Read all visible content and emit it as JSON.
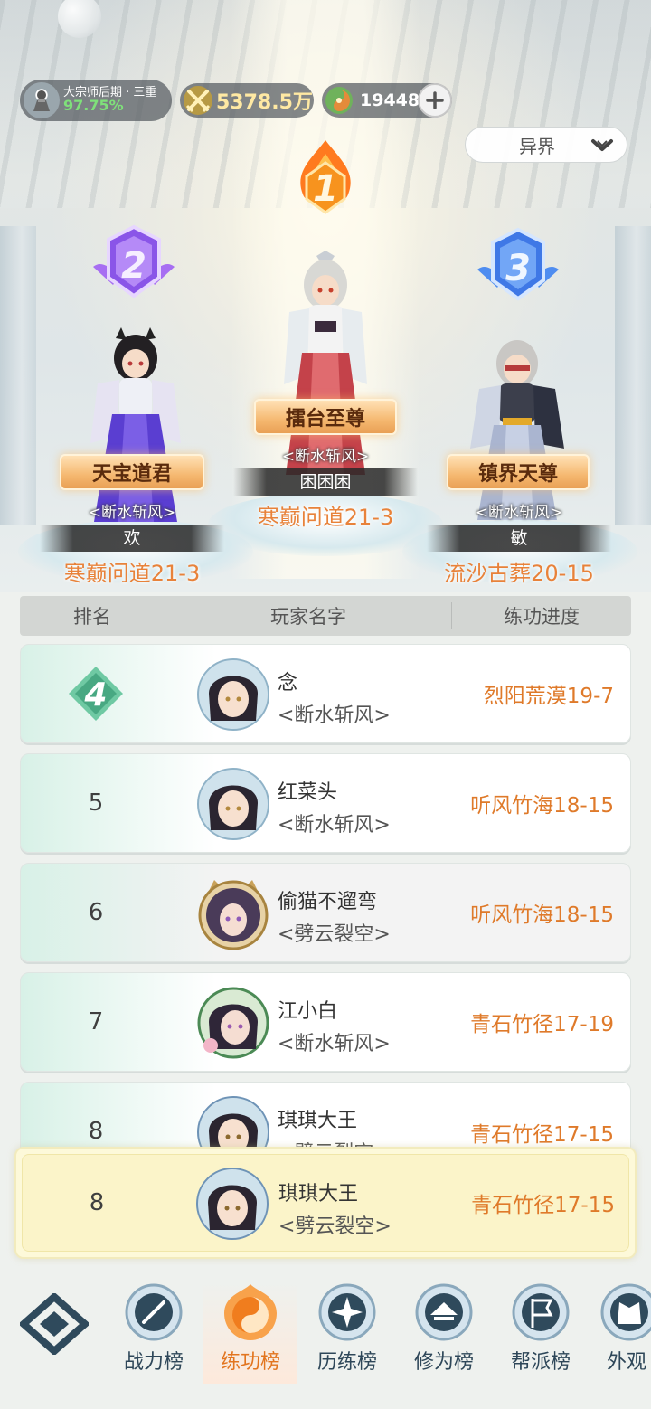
{
  "status": {
    "realm_title": "大宗师后期 · 三重",
    "realm_percent": "97.75%",
    "power": "5378.5万",
    "jade": "19448"
  },
  "filter": {
    "selected": "异界"
  },
  "top3": [
    {
      "rank": "1",
      "title": "擂台至尊",
      "guild": "<断水斩风>",
      "name": "困困困",
      "progress": "寒巅问道21-3"
    },
    {
      "rank": "2",
      "title": "天宝道君",
      "guild": "<断水斩风>",
      "name": "欢",
      "progress": "寒巅问道21-3"
    },
    {
      "rank": "3",
      "title": "镇界天尊",
      "guild": "<断水斩风>",
      "name": "敏",
      "progress": "流沙古葬20-15"
    }
  ],
  "table": {
    "headers": {
      "rank": "排名",
      "name": "玩家名字",
      "progress": "练功进度"
    },
    "rows": [
      {
        "rank": "4",
        "name": "念",
        "guild": "<断水斩风>",
        "progress": "烈阳荒漠19-7"
      },
      {
        "rank": "5",
        "name": "红菜头",
        "guild": "<断水斩风>",
        "progress": "听风竹海18-15"
      },
      {
        "rank": "6",
        "name": "偷猫不遛弯",
        "guild": "<劈云裂空>",
        "progress": "听风竹海18-15"
      },
      {
        "rank": "7",
        "name": "江小白",
        "guild": "<断水斩风>",
        "progress": "青石竹径17-19"
      },
      {
        "rank": "8",
        "name": "琪琪大王",
        "guild": "<劈云裂空>",
        "progress": "青石竹径17-15"
      }
    ],
    "mine": {
      "rank": "8",
      "name": "琪琪大王",
      "guild": "<劈云裂空>",
      "progress": "青石竹径17-15"
    }
  },
  "nav": [
    {
      "label": "战力榜",
      "icon": "sword-icon"
    },
    {
      "label": "练功榜",
      "icon": "yin-yang-icon",
      "active": true
    },
    {
      "label": "历练榜",
      "icon": "star-compass-icon"
    },
    {
      "label": "修为榜",
      "icon": "hat-icon"
    },
    {
      "label": "帮派榜",
      "icon": "banner-icon"
    },
    {
      "label": "外观",
      "icon": "costume-icon"
    }
  ],
  "colors": {
    "accent_orange": "#e2751f",
    "progress_orange": "#df7a2a",
    "nav_blue": "#2e4759",
    "percent_green": "#7fe07a"
  }
}
